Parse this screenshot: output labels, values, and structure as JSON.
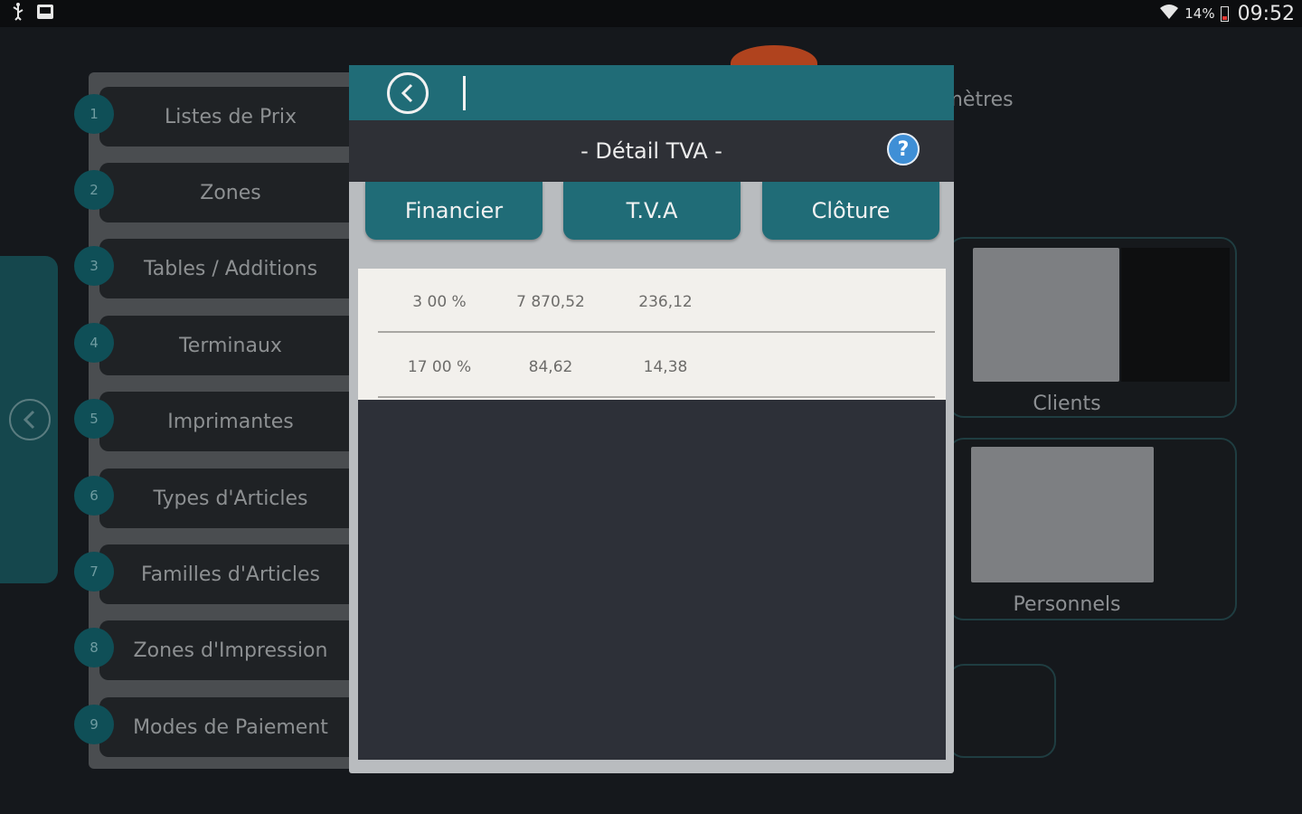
{
  "status_bar": {
    "battery": "14%",
    "time": "09:52"
  },
  "background": {
    "menu_items": [
      {
        "num": "1",
        "label": "Listes de Prix"
      },
      {
        "num": "2",
        "label": "Zones"
      },
      {
        "num": "3",
        "label": "Tables / Additions"
      },
      {
        "num": "4",
        "label": "Terminaux"
      },
      {
        "num": "5",
        "label": "Imprimantes"
      },
      {
        "num": "6",
        "label": "Types d'Articles"
      },
      {
        "num": "7",
        "label": "Familles d'Articles"
      },
      {
        "num": "8",
        "label": "Zones d'Impression"
      },
      {
        "num": "9",
        "label": "Modes de Paiement"
      }
    ],
    "title_fragment": "amètres",
    "cards": [
      {
        "label": "Clients"
      },
      {
        "label": "Personnels"
      }
    ]
  },
  "dialog": {
    "title": "- Détail TVA -",
    "help_label": "?",
    "tabs": [
      {
        "label": "Financier"
      },
      {
        "label": "T.V.A"
      },
      {
        "label": "Clôture"
      }
    ],
    "vat_rows": [
      {
        "rate": "3 00 %",
        "base": "7 870,52",
        "tax": "236,12"
      },
      {
        "rate": "17 00 %",
        "base": "84,62",
        "tax": "14,38"
      }
    ]
  },
  "colors": {
    "accent": "#206c77",
    "help": "#3f8fd6",
    "dialog_dark": "#2e3036"
  }
}
